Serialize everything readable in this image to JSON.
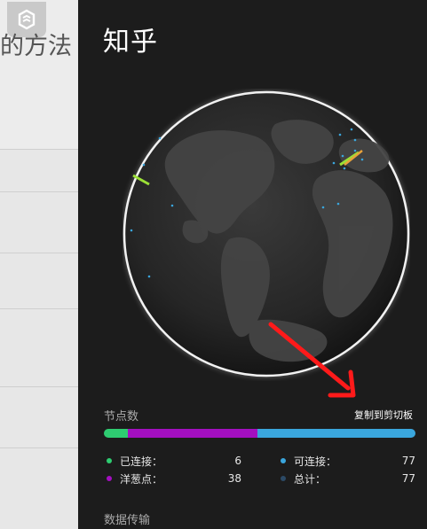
{
  "background_page": {
    "title_fragment": "的方法"
  },
  "panel": {
    "title": "知乎",
    "nodes_section_label": "节点数",
    "copy_link": "复制到剪切板",
    "data_section_label": "数据传输",
    "stats": [
      {
        "label": "已连接：",
        "value": "6",
        "color": "#2ecc71"
      },
      {
        "label": "可连接：",
        "value": "77",
        "color": "#3aa6dd"
      },
      {
        "label": "洋葱点：",
        "value": "38",
        "color": "#a30fc0"
      },
      {
        "label": "总计：",
        "value": "77",
        "color": "#2c4a66"
      }
    ],
    "bar_segments": [
      {
        "name": "connected",
        "fraction": 0.078,
        "color": "#2ecc71"
      },
      {
        "name": "onion",
        "fraction": 0.415,
        "color": "#a30fc0"
      },
      {
        "name": "available",
        "fraction": 0.507,
        "color": "#3aa6dd"
      }
    ]
  },
  "icons": {
    "app_logo": "app-logo-icon",
    "annotation": "red-arrow-icon"
  }
}
